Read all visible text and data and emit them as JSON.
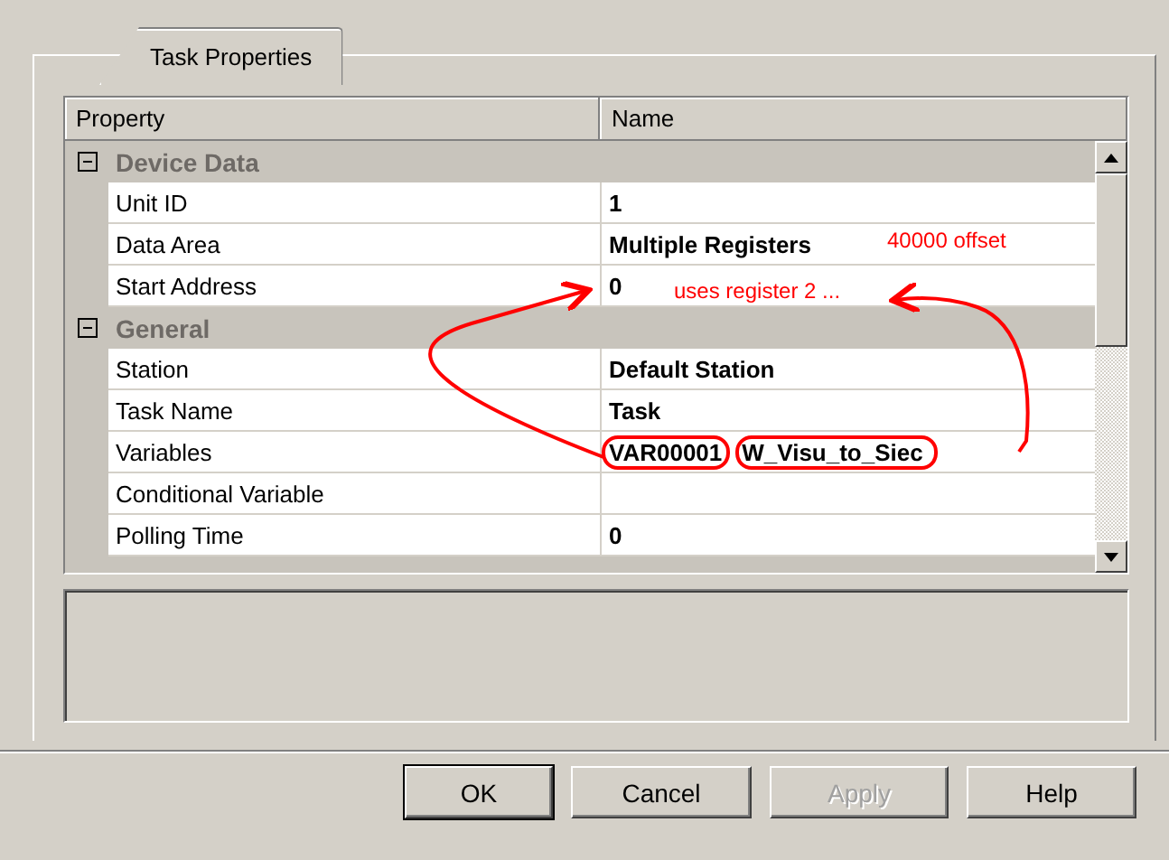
{
  "tab": {
    "label": "Task Properties",
    "selected": true
  },
  "grid": {
    "columns": [
      "Property",
      "Name"
    ],
    "categories": [
      {
        "name": "Device Data",
        "expanded": true,
        "rows": [
          {
            "property": "Unit ID",
            "values": [
              "1"
            ]
          },
          {
            "property": "Data Area",
            "values": [
              "Multiple Registers"
            ]
          },
          {
            "property": "Start Address",
            "values": [
              "0"
            ]
          }
        ]
      },
      {
        "name": "General",
        "expanded": true,
        "rows": [
          {
            "property": "Station",
            "values": [
              "Default Station"
            ]
          },
          {
            "property": "Task Name",
            "values": [
              "Task"
            ]
          },
          {
            "property": "Variables",
            "values": [
              "VAR00001",
              "W_Visu_to_Siec"
            ],
            "circled": true
          },
          {
            "property": "Conditional Variable",
            "values": []
          },
          {
            "property": "Polling Time",
            "values": [
              "0"
            ]
          }
        ]
      }
    ]
  },
  "annotations": [
    {
      "kind": "note",
      "text": "40000 offset"
    },
    {
      "kind": "note",
      "text": "uses register 2 ..."
    }
  ],
  "buttons": [
    {
      "label": "OK",
      "default": true,
      "disabled": false
    },
    {
      "label": "Cancel",
      "default": false,
      "disabled": false
    },
    {
      "label": "Apply",
      "default": false,
      "disabled": true
    },
    {
      "label": "Help",
      "default": false,
      "disabled": false
    }
  ]
}
